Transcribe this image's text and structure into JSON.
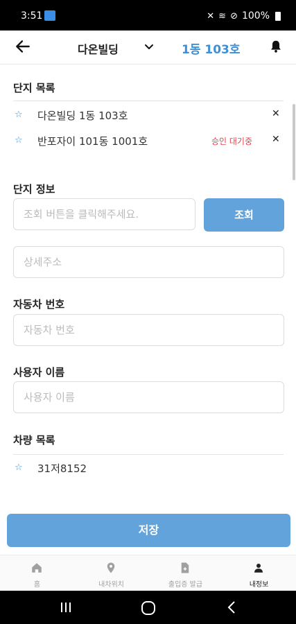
{
  "status_bar": {
    "time": "3:51",
    "battery": "100%"
  },
  "header": {
    "building": "다온빌딩",
    "unit": "1동 103호"
  },
  "complex_list": {
    "title": "단지 목록",
    "items": [
      {
        "name": "다온빌딩 1동 103호",
        "status": ""
      },
      {
        "name": "반포자이 101동 1001호",
        "status": "승인 대기중"
      }
    ]
  },
  "complex_info": {
    "title": "단지 정보",
    "search_placeholder": "조회 버튼을 클릭해주세요.",
    "search_button": "조회",
    "address_placeholder": "상세주소"
  },
  "car_number": {
    "title": "자동차 번호",
    "placeholder": "자동차 번호"
  },
  "user_name": {
    "title": "사용자 이름",
    "placeholder": "사용자 이름"
  },
  "vehicle_list": {
    "title": "차량 목록",
    "items": [
      "31저8152"
    ]
  },
  "save_button": "저장",
  "bottom_nav": [
    {
      "label": "홈",
      "icon": "home-icon",
      "active": false
    },
    {
      "label": "내차위치",
      "icon": "location-pin-icon",
      "active": false
    },
    {
      "label": "출입증 발급",
      "icon": "document-icon",
      "active": false
    },
    {
      "label": "내정보",
      "icon": "person-icon",
      "active": true
    }
  ],
  "colors": {
    "accent": "#3d8fd6",
    "button": "#62a3dc",
    "pending": "#e8424d"
  }
}
